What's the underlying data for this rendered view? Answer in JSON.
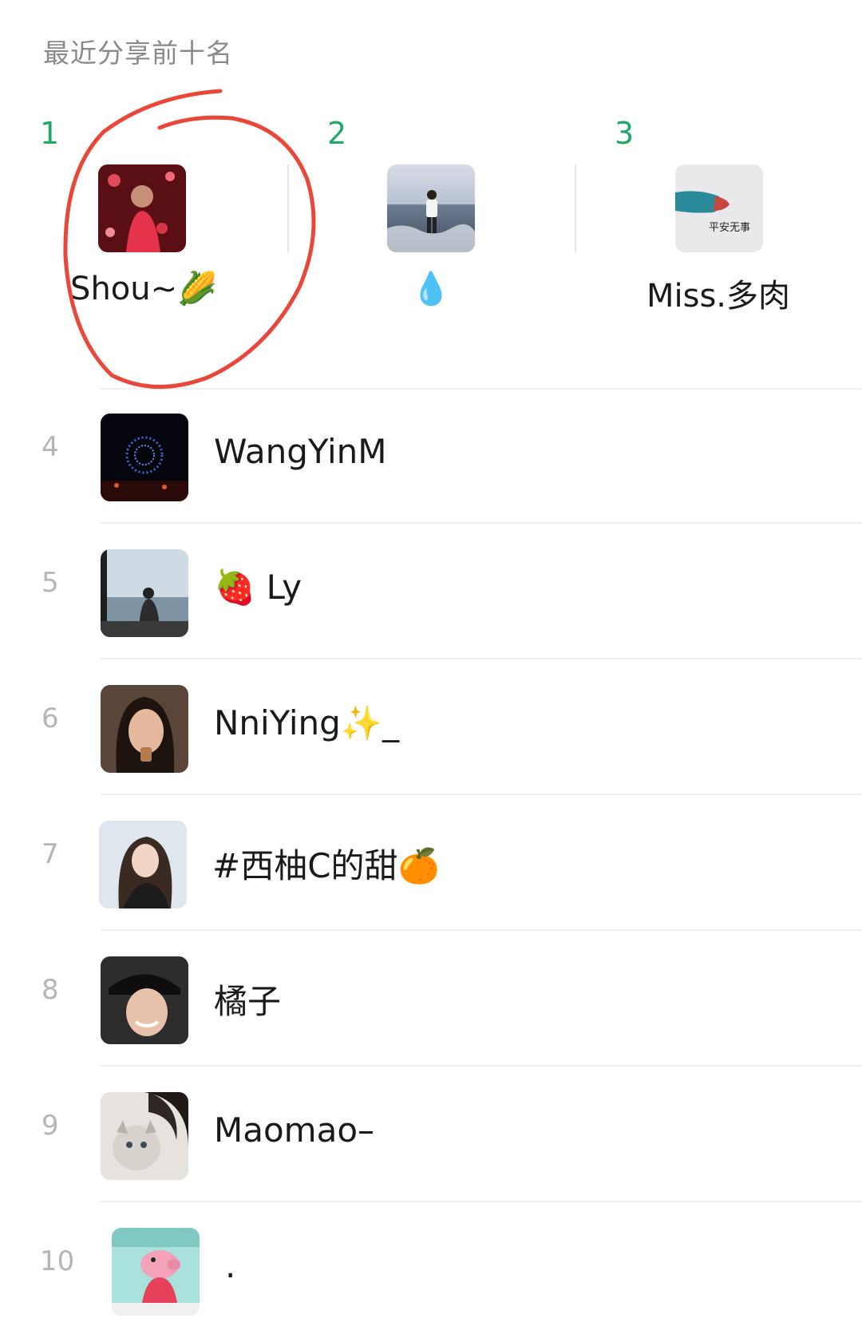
{
  "section": {
    "title": "最近分享前十名"
  },
  "podium": [
    {
      "rank": "1",
      "name": "Shou~🌽"
    },
    {
      "rank": "2",
      "name": "💧"
    },
    {
      "rank": "3",
      "name": "Miss.多肉",
      "avatar_caption": "平安无事"
    }
  ],
  "list": [
    {
      "rank": "4",
      "name": "WangYinM"
    },
    {
      "rank": "5",
      "name": "🍓 Ly"
    },
    {
      "rank": "6",
      "name": "NniYing✨_"
    },
    {
      "rank": "7",
      "name": "#西柚C的甜🍊"
    },
    {
      "rank": "8",
      "name": "橘子"
    },
    {
      "rank": "9",
      "name": "Maomao–"
    },
    {
      "rank": "10",
      "name": "."
    }
  ],
  "colors": {
    "accent_rank": "#1fa86a",
    "annotation_circle": "#e8473a"
  }
}
